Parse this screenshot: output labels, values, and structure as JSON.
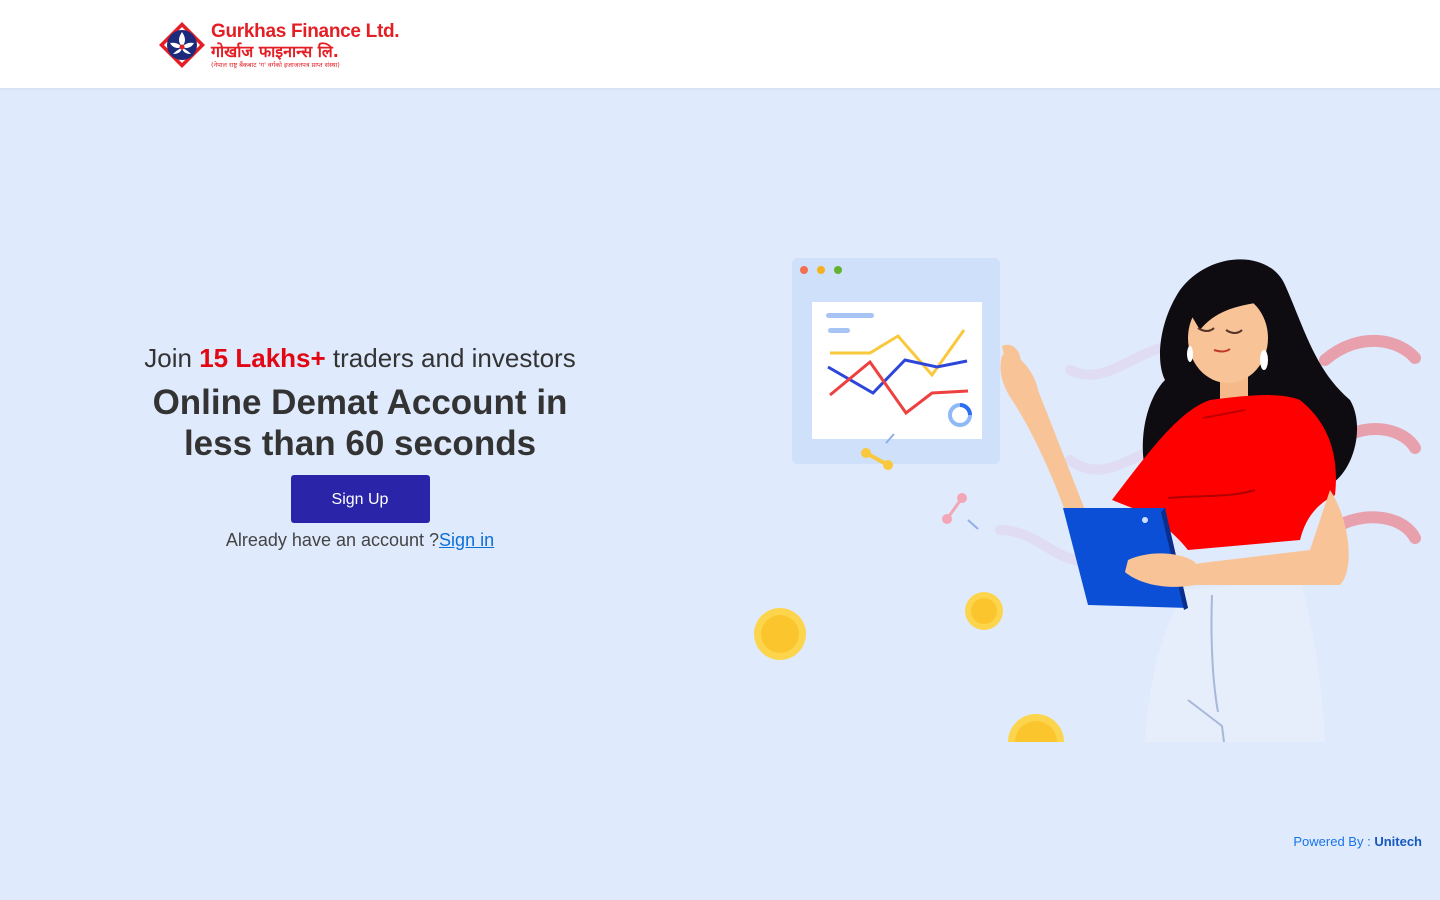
{
  "header": {
    "logo": {
      "name_en": "Gurkhas Finance Ltd.",
      "name_np": "गोर्खाज फाइनान्स लि.",
      "tagline": "(नेपाल राष्ट्र बैंकबाट 'ग' वर्गको इजाजतपत्र प्राप्त संस्था)"
    }
  },
  "hero": {
    "join_prefix": "Join ",
    "join_highlight": "15 Lakhs+",
    "join_suffix": " traders and investors",
    "title_line1": "Online Demat Account in",
    "title_line2": "less than 60 seconds",
    "signup_label": "Sign Up",
    "already_text": "Already have an account ?",
    "signin_label": "Sign in"
  },
  "footer": {
    "powered_label": "Powered By : ",
    "powered_brand": "Unitech"
  },
  "colors": {
    "primary_button": "#2a25a8",
    "highlight": "#e30613",
    "link": "#0c6fd9",
    "background": "#dfeafc"
  }
}
